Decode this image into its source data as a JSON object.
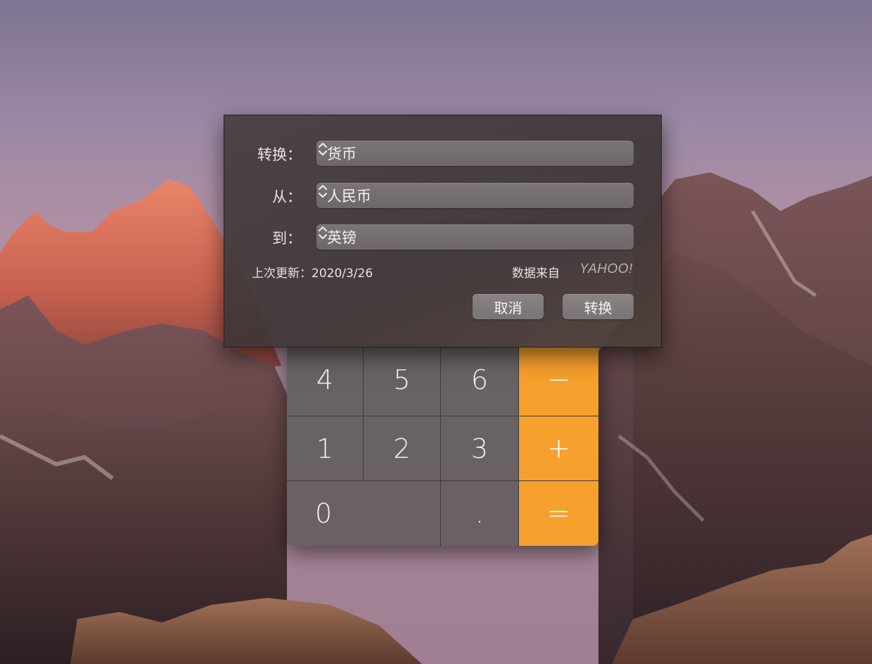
{
  "dialog": {
    "convert_label": "转换：",
    "convert_value": "货币",
    "from_label": "从：",
    "from_value": "人民币",
    "to_label": "到：",
    "to_value": "英镑",
    "last_updated_label": "上次更新：",
    "last_updated_value": "2020/3/26",
    "data_source_label": "数据来自",
    "data_source_logo": "YAHOO!",
    "cancel_label": "取消",
    "convert_button_label": "转换"
  },
  "calculator": {
    "keys": {
      "k4": "4",
      "k5": "5",
      "k6": "6",
      "minus": "−",
      "k1": "1",
      "k2": "2",
      "k3": "3",
      "plus": "+",
      "k0": "0",
      "dot": ".",
      "equals": "="
    },
    "colors": {
      "operator": "#f6a02d",
      "digit": "#696263"
    }
  }
}
